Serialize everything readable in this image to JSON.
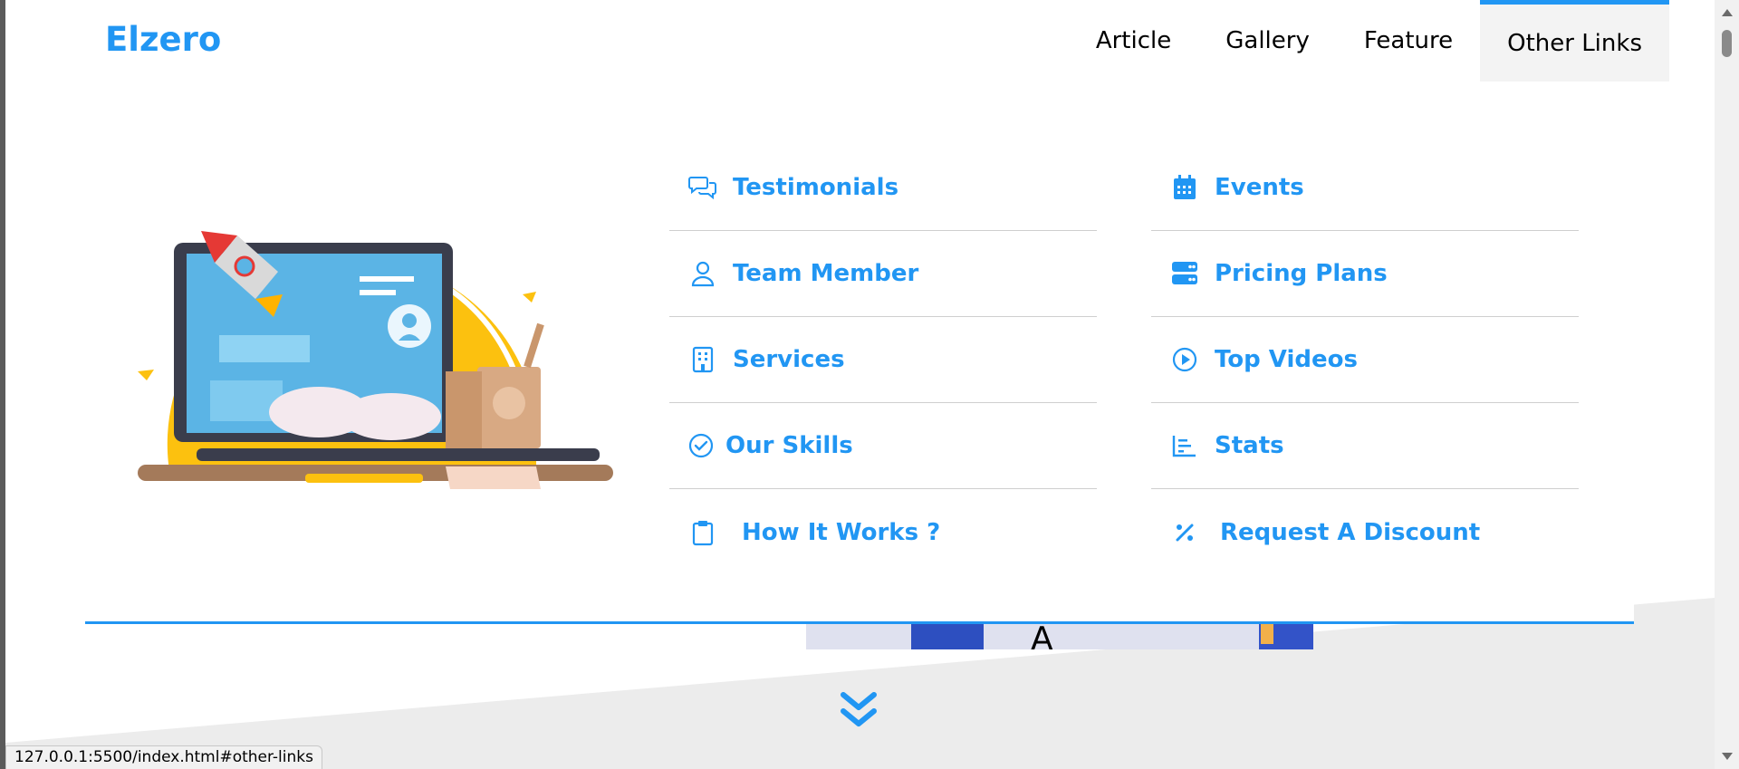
{
  "brand": "Elzero",
  "nav": [
    {
      "label": "Article",
      "active": false
    },
    {
      "label": "Gallery",
      "active": false
    },
    {
      "label": "Feature",
      "active": false
    },
    {
      "label": "Other Links",
      "active": true
    }
  ],
  "mega_menu": {
    "column_1": [
      {
        "label": "Testimonials",
        "icon": "comments-icon"
      },
      {
        "label": "Team Member",
        "icon": "user-icon"
      },
      {
        "label": "Services",
        "icon": "building-icon"
      },
      {
        "label": "Our Skills",
        "icon": "check-circle-icon"
      },
      {
        "label": "How It Works ?",
        "icon": "clipboard-icon"
      }
    ],
    "column_2": [
      {
        "label": "Events",
        "icon": "calendar-icon"
      },
      {
        "label": "Pricing Plans",
        "icon": "server-icon"
      },
      {
        "label": "Top Videos",
        "icon": "play-circle-icon"
      },
      {
        "label": "Stats",
        "icon": "chart-bar-icon"
      },
      {
        "label": "Request A Discount",
        "icon": "percent-icon"
      }
    ]
  },
  "status_url": "127.0.0.1:5500/index.html#other-links",
  "colors": {
    "accent": "#2196f3",
    "background": "#ececec",
    "active_nav_bg": "#f3f3f3"
  }
}
